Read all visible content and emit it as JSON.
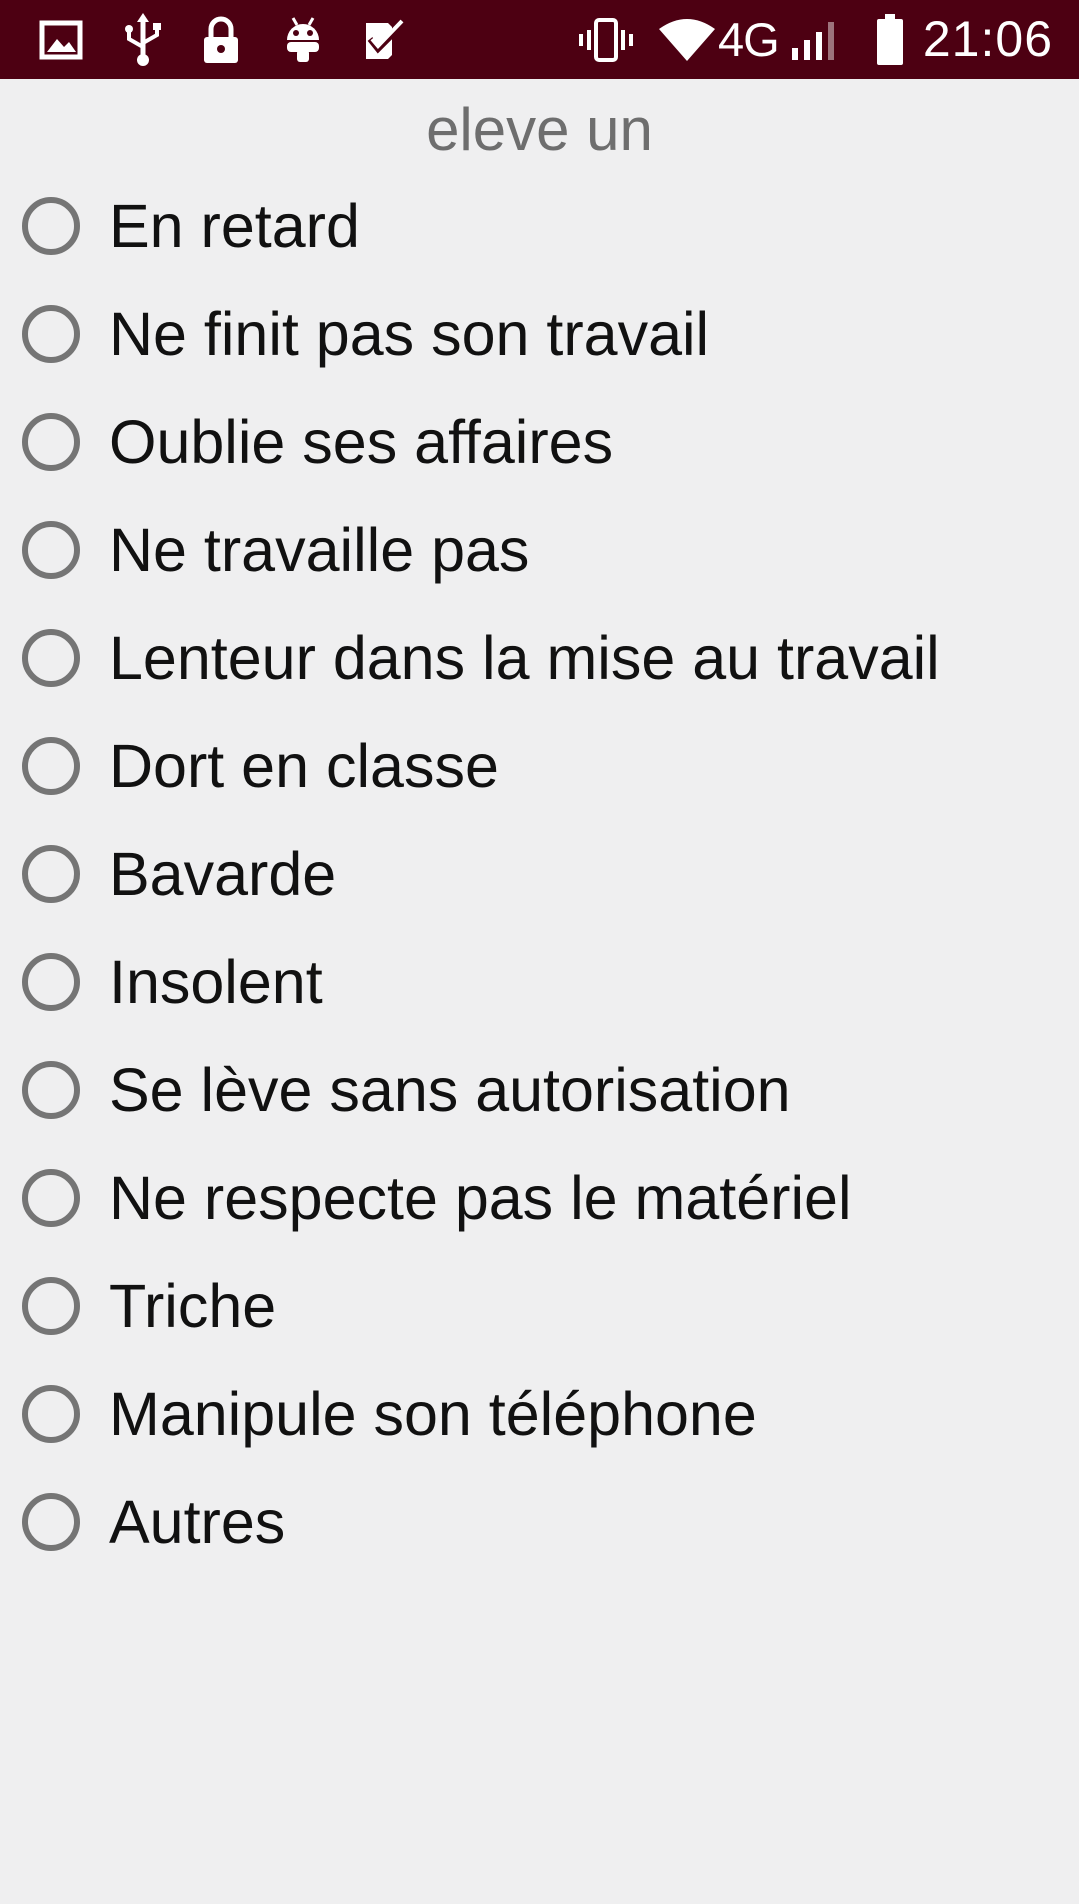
{
  "status_bar": {
    "time": "21:06",
    "network": "4G",
    "icons": [
      "image-icon",
      "usb-icon",
      "lock-icon",
      "android-icon",
      "checkbox-app-icon",
      "vibrate-icon",
      "wifi-icon",
      "signal-icon",
      "battery-icon"
    ]
  },
  "title": "eleve un",
  "options": [
    {
      "label": "En retard",
      "selected": false
    },
    {
      "label": "Ne finit pas son travail",
      "selected": false
    },
    {
      "label": "Oublie ses affaires",
      "selected": false
    },
    {
      "label": "Ne travaille pas",
      "selected": false
    },
    {
      "label": "Lenteur dans la mise au travail",
      "selected": false
    },
    {
      "label": "Dort en classe",
      "selected": false
    },
    {
      "label": "Bavarde",
      "selected": false
    },
    {
      "label": "Insolent",
      "selected": false
    },
    {
      "label": "Se lève sans autorisation",
      "selected": false
    },
    {
      "label": "Ne respecte pas le matériel",
      "selected": false
    },
    {
      "label": "Triche",
      "selected": false
    },
    {
      "label": "Manipule son téléphone",
      "selected": false
    },
    {
      "label": "Autres",
      "selected": false
    }
  ],
  "colors": {
    "status_bar": "#4d0012",
    "background": "#efeff0",
    "radio": "#757575"
  }
}
